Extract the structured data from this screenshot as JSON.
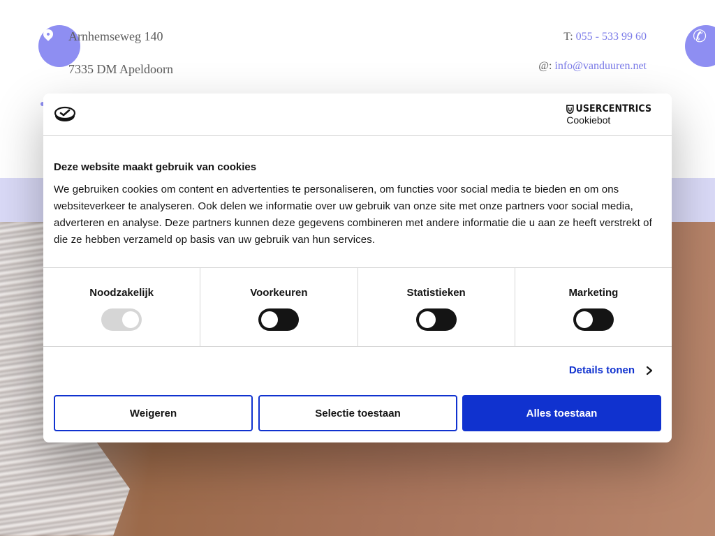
{
  "header": {
    "address_line_1": "Arnhemseweg 140",
    "address_line_2": "7335 DM Apeldoorn",
    "phone_prefix": "T:",
    "phone": "055 - 533 99 60",
    "email_prefix": "@:",
    "email": "info@vanduuren.net",
    "icons": {
      "location": "map-pin-icon",
      "phone": "phone-icon"
    },
    "accent_color": "#8e8ef2"
  },
  "cookie_dialog": {
    "brand_name": "USERCENTRICS",
    "brand_sub": "Cookiebot",
    "title": "Deze website maakt gebruik van cookies",
    "description": "We gebruiken cookies om content en advertenties te personaliseren, om functies voor social media te bieden en om ons websiteverkeer te analyseren. Ook delen we informatie over uw gebruik van onze site met onze partners voor social media, adverteren en analyse. Deze partners kunnen deze gegevens combineren met andere informatie die u aan ze heeft verstrekt of die ze hebben verzameld op basis van uw gebruik van hun services.",
    "toggles": [
      {
        "label": "Noodzakelijk",
        "checked": true,
        "disabled": true
      },
      {
        "label": "Voorkeuren",
        "checked": false,
        "disabled": false
      },
      {
        "label": "Statistieken",
        "checked": false,
        "disabled": false
      },
      {
        "label": "Marketing",
        "checked": false,
        "disabled": false
      }
    ],
    "details_label": "Details tonen",
    "buttons": {
      "refuse": "Weigeren",
      "selection": "Selectie toestaan",
      "allow_all": "Alles toestaan"
    },
    "accent_color": "#1032cf"
  }
}
